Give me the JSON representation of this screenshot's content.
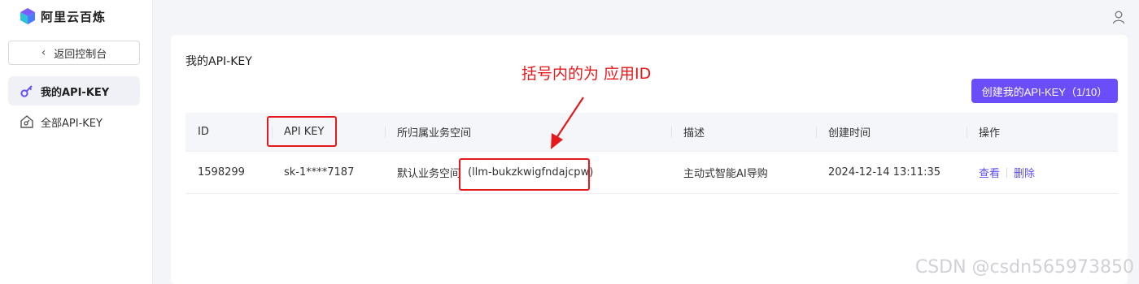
{
  "brand": {
    "name": "阿里云百炼"
  },
  "sidebar": {
    "back_label": "返回控制台",
    "items": [
      {
        "label": "我的API-KEY",
        "icon": "key-icon",
        "active": true
      },
      {
        "label": "全部API-KEY",
        "icon": "house-key-icon",
        "active": false
      }
    ]
  },
  "header": {
    "user_icon": "user-icon"
  },
  "main": {
    "title": "我的API-KEY",
    "create_button": "创建我的API-KEY（1/10）",
    "table": {
      "columns": [
        "ID",
        "API KEY",
        "所归属业务空间",
        "描述",
        "创建时间",
        "操作"
      ],
      "rows": [
        {
          "id": "1598299",
          "api_key": "sk-1****7187",
          "workspace": "默认业务空间",
          "workspace_id": "(llm-bukzkwigfndajcpw)",
          "description": "主动式智能AI导购",
          "created": "2024-12-14 13:11:35",
          "actions": [
            "查看",
            "删除"
          ]
        }
      ]
    }
  },
  "annotation": {
    "text": "括号内的为 应用ID"
  },
  "watermark": "CSDN @csdn565973850",
  "colors": {
    "accent": "#6b4dfa",
    "link": "#5a4ef2",
    "annotation": "#e5191c"
  }
}
